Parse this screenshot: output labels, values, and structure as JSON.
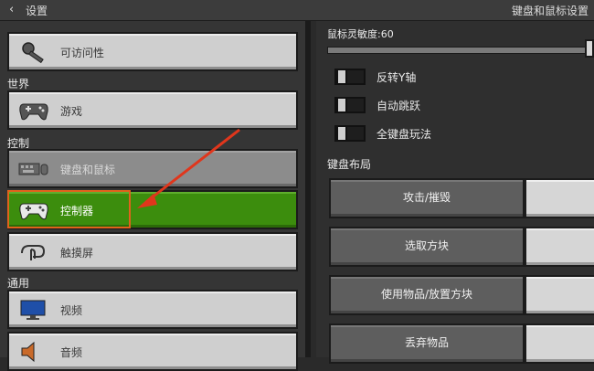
{
  "topbar": {
    "back_icon": "chevron-left-icon",
    "title": "设置",
    "right_title": "键盘和鼠标设置"
  },
  "left": {
    "items": [
      {
        "label": "可访问性",
        "icon": "key-icon",
        "state": "normal"
      },
      {
        "label": "游戏",
        "icon": "gamepad-icon",
        "state": "normal"
      },
      {
        "label": "键盘和鼠标",
        "icon": "keyboard-mouse-icon",
        "state": "disabled"
      },
      {
        "label": "控制器",
        "icon": "gamepad-icon",
        "state": "active"
      },
      {
        "label": "触摸屏",
        "icon": "touch-hand-icon",
        "state": "normal"
      },
      {
        "label": "视频",
        "icon": "monitor-icon",
        "state": "normal"
      },
      {
        "label": "音频",
        "icon": "speaker-icon",
        "state": "normal"
      }
    ],
    "sections": {
      "world": "世界",
      "control": "控制",
      "general": "通用"
    },
    "active_color": "#3c8d0d",
    "highlight_color": "#e0621c"
  },
  "right": {
    "sensitivity": {
      "label": "鼠标灵敏度:60",
      "value": 60
    },
    "toggles": [
      {
        "label": "反转Y轴",
        "on": false
      },
      {
        "label": "自动跳跃",
        "on": false
      },
      {
        "label": "全键盘玩法",
        "on": false
      }
    ],
    "layout_label": "键盘布局",
    "bindings": [
      {
        "action": "攻击/摧毁"
      },
      {
        "action": "选取方块"
      },
      {
        "action": "使用物品/放置方块"
      },
      {
        "action": "丢弃物品"
      }
    ]
  }
}
